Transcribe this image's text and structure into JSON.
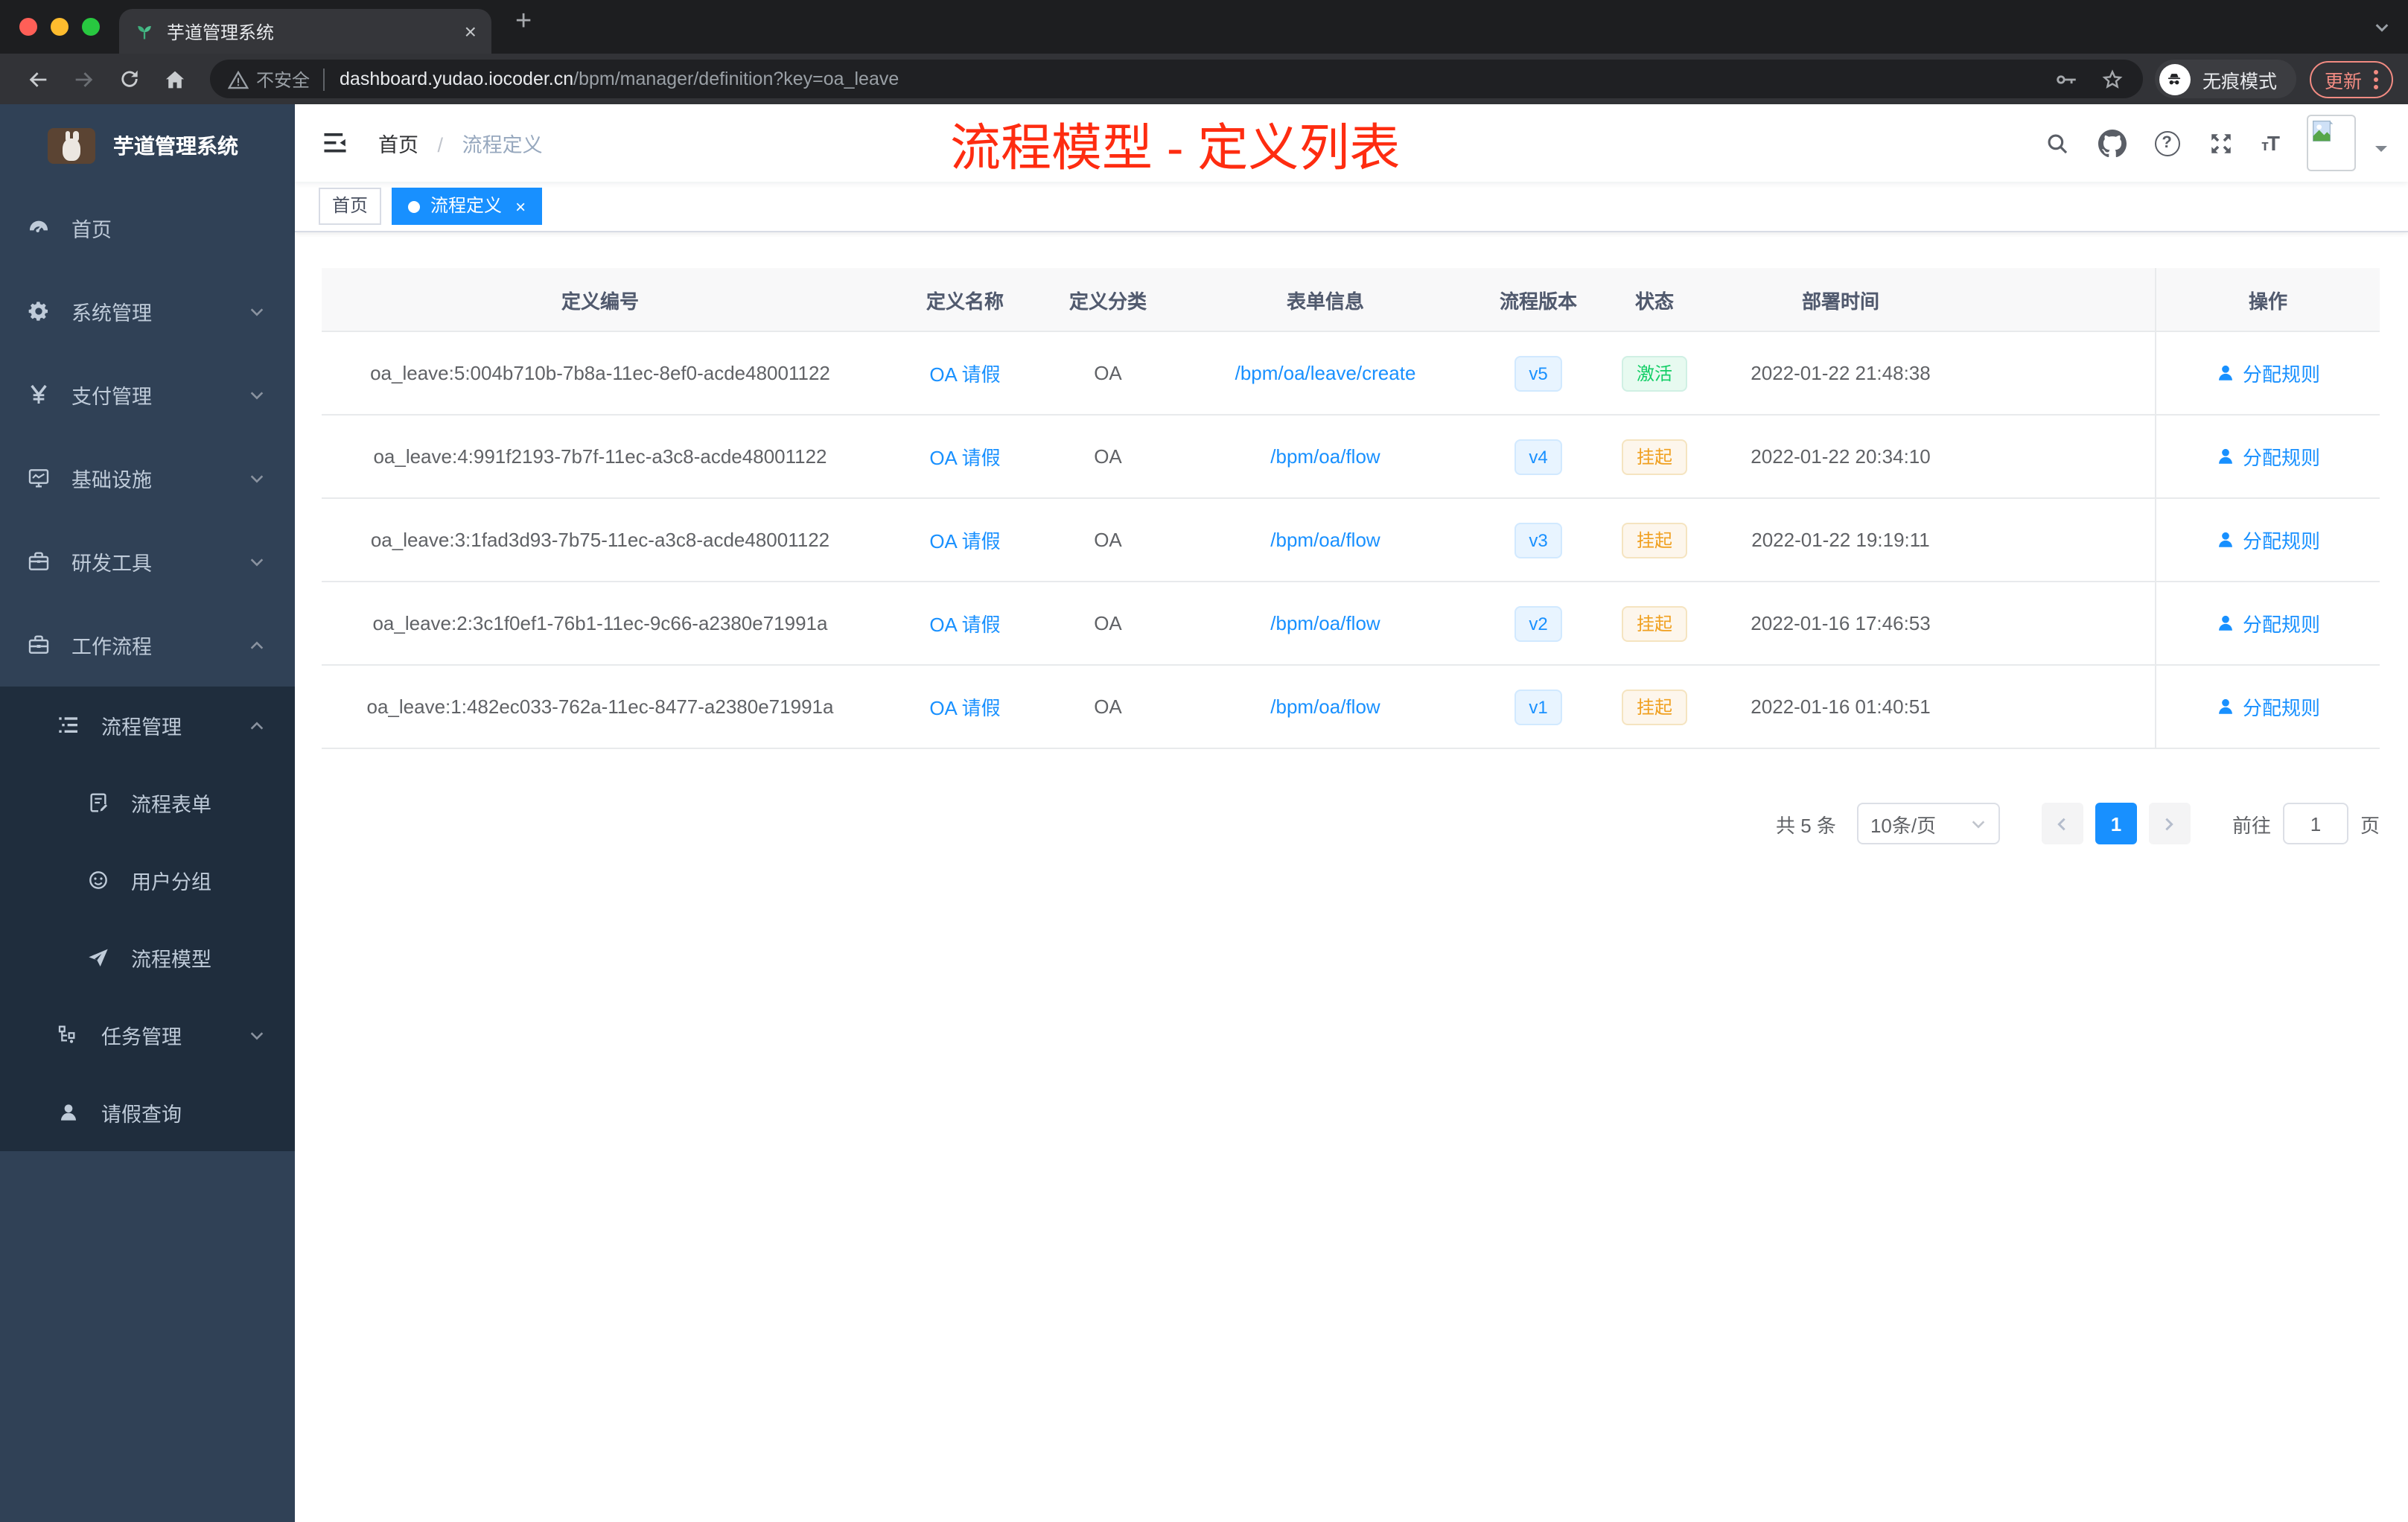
{
  "browser": {
    "traffic_lights": [
      "#ff5f57",
      "#febc2e",
      "#28c840"
    ],
    "tab_title": "芋道管理系统",
    "tab_close_glyph": "×",
    "new_tab_glyph": "+",
    "url_warning": "不安全",
    "url_domain": "dashboard.yudao.iocoder.cn",
    "url_path": "/bpm/manager/definition?key=oa_leave",
    "incognito_label": "无痕模式",
    "update_label": "更新"
  },
  "sidebar": {
    "logo_title": "芋道管理系统",
    "items": [
      {
        "label": "首页",
        "icon": "dashboard-icon"
      },
      {
        "label": "系统管理",
        "icon": "gear-icon",
        "expandable": true
      },
      {
        "label": "支付管理",
        "icon": "yuan-icon",
        "expandable": true
      },
      {
        "label": "基础设施",
        "icon": "monitor-icon",
        "expandable": true
      },
      {
        "label": "研发工具",
        "icon": "toolbox-icon",
        "expandable": true
      },
      {
        "label": "工作流程",
        "icon": "briefcase-icon",
        "expanded": true,
        "children": [
          {
            "label": "流程管理",
            "icon": "list-icon",
            "expanded": true,
            "children": [
              {
                "label": "流程表单",
                "icon": "form-icon"
              },
              {
                "label": "用户分组",
                "icon": "group-icon"
              },
              {
                "label": "流程模型",
                "icon": "send-icon"
              }
            ]
          },
          {
            "label": "任务管理",
            "icon": "tree-icon",
            "expandable": true
          },
          {
            "label": "请假查询",
            "icon": "user-icon"
          }
        ]
      }
    ]
  },
  "header": {
    "breadcrumb": [
      "首页",
      "流程定义"
    ],
    "breadcrumb_sep": "/",
    "annotation": "流程模型 - 定义列表",
    "annotation_color": "#fe2c10",
    "help_glyph": "?",
    "font_glyph_small": "т",
    "font_glyph_big": "T"
  },
  "tags": {
    "items": [
      {
        "label": "首页",
        "active": false
      },
      {
        "label": "流程定义",
        "active": true,
        "closable": true
      }
    ],
    "close_glyph": "×"
  },
  "table": {
    "columns": [
      "定义编号",
      "定义名称",
      "定义分类",
      "表单信息",
      "流程版本",
      "状态",
      "部署时间",
      "操作"
    ],
    "rows": [
      {
        "id": "oa_leave:5:004b710b-7b8a-11ec-8ef0-acde48001122",
        "name": "OA 请假",
        "category": "OA",
        "form": "/bpm/oa/leave/create",
        "version": "v5",
        "status": "激活",
        "status_type": "success",
        "deploy_time": "2022-01-22 21:48:38",
        "action": "分配规则"
      },
      {
        "id": "oa_leave:4:991f2193-7b7f-11ec-a3c8-acde48001122",
        "name": "OA 请假",
        "category": "OA",
        "form": "/bpm/oa/flow",
        "version": "v4",
        "status": "挂起",
        "status_type": "warning",
        "deploy_time": "2022-01-22 20:34:10",
        "action": "分配规则"
      },
      {
        "id": "oa_leave:3:1fad3d93-7b75-11ec-a3c8-acde48001122",
        "name": "OA 请假",
        "category": "OA",
        "form": "/bpm/oa/flow",
        "version": "v3",
        "status": "挂起",
        "status_type": "warning",
        "deploy_time": "2022-01-22 19:19:11",
        "action": "分配规则"
      },
      {
        "id": "oa_leave:2:3c1f0ef1-76b1-11ec-9c66-a2380e71991a",
        "name": "OA 请假",
        "category": "OA",
        "form": "/bpm/oa/flow",
        "version": "v2",
        "status": "挂起",
        "status_type": "warning",
        "deploy_time": "2022-01-16 17:46:53",
        "action": "分配规则"
      },
      {
        "id": "oa_leave:1:482ec033-762a-11ec-8477-a2380e71991a",
        "name": "OA 请假",
        "category": "OA",
        "form": "/bpm/oa/flow",
        "version": "v1",
        "status": "挂起",
        "status_type": "warning",
        "deploy_time": "2022-01-16 01:40:51",
        "action": "分配规则"
      }
    ]
  },
  "pagination": {
    "total": "共 5 条",
    "page_size": "10条/页",
    "current_page": "1",
    "goto_label": "前往",
    "goto_value": "1",
    "page_label": "页"
  },
  "colors": {
    "accent": "#1890ff",
    "success": "#13ce66",
    "warning": "#f0a020",
    "sidebar_bg": "#304156",
    "submenu_bg": "#1f2d3d",
    "annotation_red": "#fe2c10",
    "update_salmon": "#f28b82"
  }
}
